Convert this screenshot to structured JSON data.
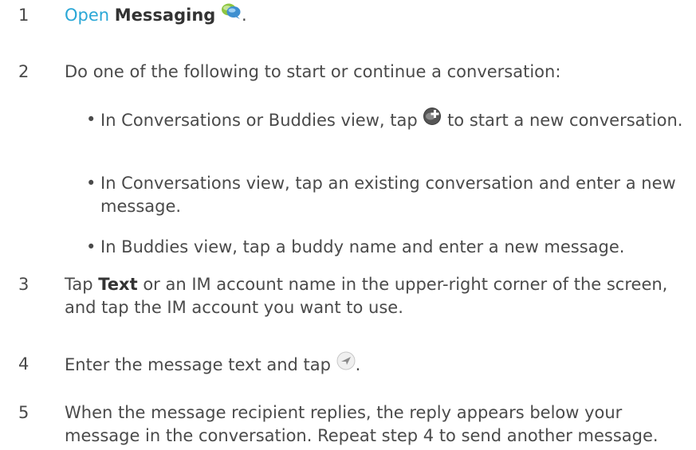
{
  "steps": [
    {
      "number": "1",
      "open_link": "Open",
      "app_name": "Messaging",
      "after": ".",
      "icon": "messaging-app-icon"
    },
    {
      "number": "2",
      "text": "Do one of the following to start or continue a conversation:",
      "bullets": [
        {
          "symbol": "•",
          "before": "In Conversations or Buddies view, tap",
          "icon": "new-conversation-plus-icon",
          "after": "to start a new conversation."
        },
        {
          "symbol": "•",
          "text": "In Conversations view, tap an existing conversation and enter a new message."
        },
        {
          "symbol": "•",
          "text": "In Buddies view, tap a buddy name and enter a new message."
        }
      ]
    },
    {
      "number": "3",
      "tap": "Tap",
      "bold": "Text",
      "after": "or an IM account name in the upper-right corner of the screen, and tap the IM account you want to use."
    },
    {
      "number": "4",
      "before": "Enter the message text and tap",
      "icon": "send-icon",
      "after": "."
    },
    {
      "number": "5",
      "text": "When the message recipient replies, the reply appears below your message in the conversation. Repeat step 4 to send another message."
    }
  ],
  "colors": {
    "body_text": "#4a4a4a",
    "link": "#2aa7d6"
  }
}
